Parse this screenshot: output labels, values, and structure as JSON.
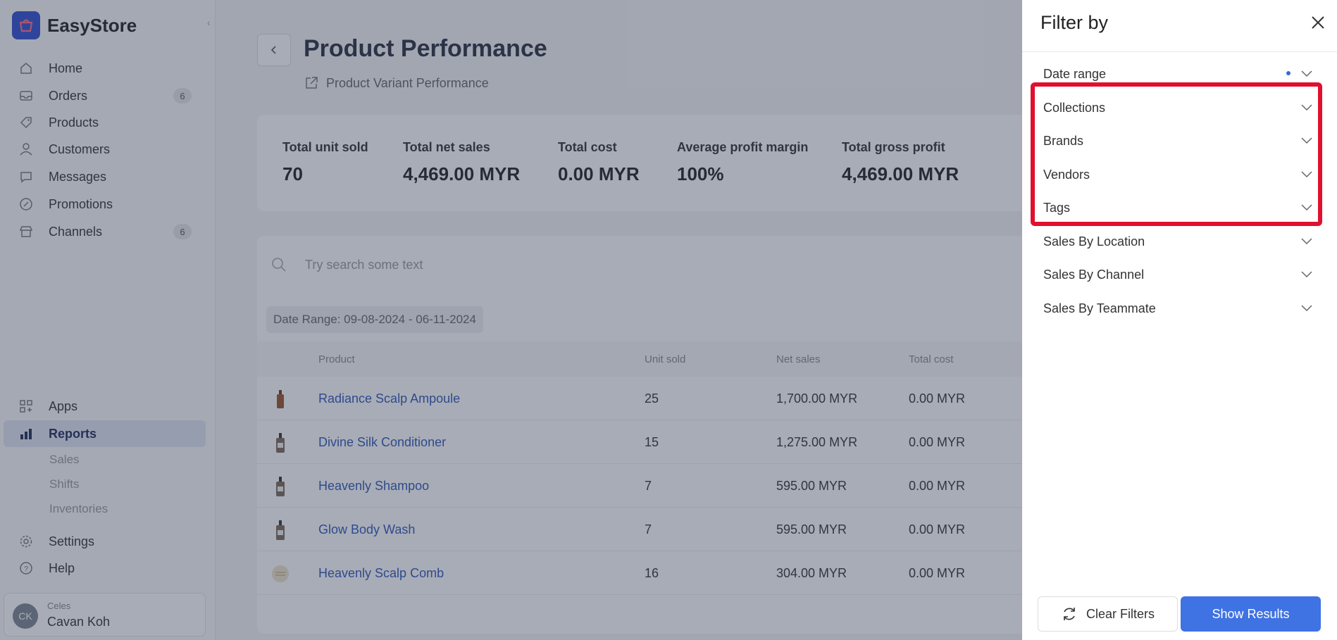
{
  "app": {
    "name": "EasyStore"
  },
  "sidebar": {
    "items": [
      {
        "label": "Home",
        "icon": "home-icon"
      },
      {
        "label": "Orders",
        "icon": "inbox-icon",
        "badge": "6"
      },
      {
        "label": "Products",
        "icon": "tag-icon"
      },
      {
        "label": "Customers",
        "icon": "user-icon"
      },
      {
        "label": "Messages",
        "icon": "chat-icon"
      },
      {
        "label": "Promotions",
        "icon": "discount-badge-icon"
      },
      {
        "label": "Channels",
        "icon": "store-icon",
        "badge": "6"
      }
    ],
    "bottom_items": [
      {
        "label": "Apps",
        "icon": "apps-grid-icon"
      },
      {
        "label": "Reports",
        "icon": "bar-chart-icon",
        "active": true
      }
    ],
    "report_subitems": [
      "Sales",
      "Shifts",
      "Inventories"
    ],
    "footer_items": [
      {
        "label": "Settings",
        "icon": "gear-icon"
      },
      {
        "label": "Help",
        "icon": "help-icon"
      }
    ],
    "user": {
      "initials": "CK",
      "org": "Celes",
      "name": "Cavan Koh"
    }
  },
  "page": {
    "title": "Product Performance",
    "sub_link": "Product Variant Performance"
  },
  "summary": [
    {
      "label": "Total unit sold",
      "value": "70"
    },
    {
      "label": "Total net sales",
      "value": "4,469.00 MYR"
    },
    {
      "label": "Total cost",
      "value": "0.00 MYR"
    },
    {
      "label": "Average profit margin",
      "value": "100%"
    },
    {
      "label": "Total gross profit",
      "value": "4,469.00 MYR"
    }
  ],
  "search": {
    "placeholder": "Try search some text"
  },
  "date_chip": "Date Range: 09-08-2024 - 06-11-2024",
  "table": {
    "columns": [
      "Product",
      "Unit sold",
      "Net sales",
      "Total cost"
    ],
    "rows": [
      {
        "product": "Radiance Scalp Ampoule",
        "unit_sold": "25",
        "net_sales": "1,700.00 MYR",
        "total_cost": "0.00 MYR"
      },
      {
        "product": "Divine Silk Conditioner",
        "unit_sold": "15",
        "net_sales": "1,275.00 MYR",
        "total_cost": "0.00 MYR"
      },
      {
        "product": "Heavenly Shampoo",
        "unit_sold": "7",
        "net_sales": "595.00 MYR",
        "total_cost": "0.00 MYR"
      },
      {
        "product": "Glow Body Wash",
        "unit_sold": "7",
        "net_sales": "595.00 MYR",
        "total_cost": "0.00 MYR"
      },
      {
        "product": "Heavenly Scalp Comb",
        "unit_sold": "16",
        "net_sales": "304.00 MYR",
        "total_cost": "0.00 MYR"
      }
    ]
  },
  "filter_panel": {
    "title": "Filter by",
    "items": [
      {
        "label": "Date range",
        "active": true
      },
      {
        "label": "Collections"
      },
      {
        "label": "Brands"
      },
      {
        "label": "Vendors"
      },
      {
        "label": "Tags"
      },
      {
        "label": "Sales By Location"
      },
      {
        "label": "Sales By Channel"
      },
      {
        "label": "Sales By Teammate"
      }
    ],
    "clear_label": "Clear Filters",
    "show_label": "Show Results"
  },
  "colors": {
    "accent": "#3f72e3",
    "highlight": "#e0102e",
    "link": "#2e57b8"
  }
}
